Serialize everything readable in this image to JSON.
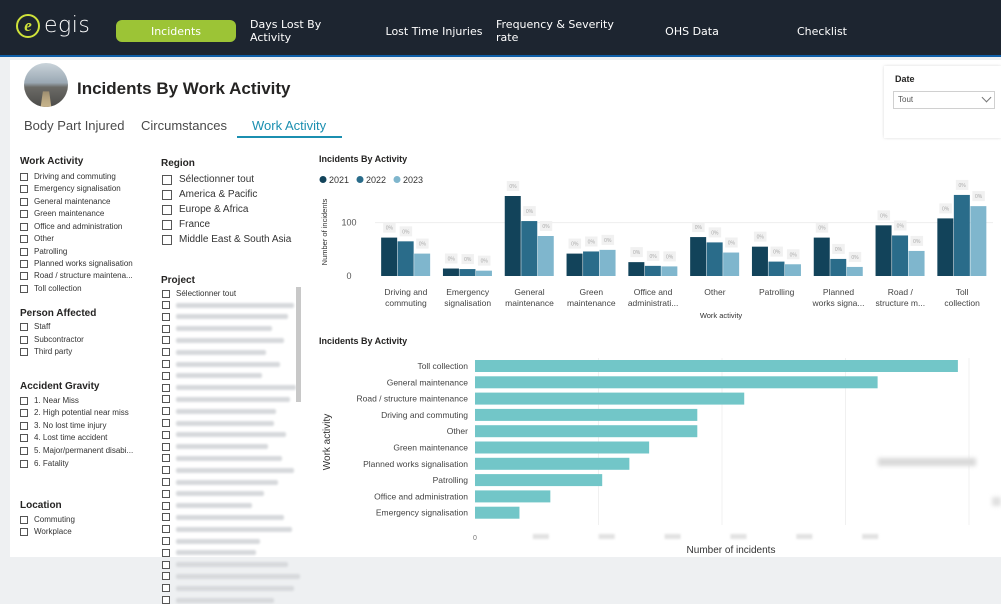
{
  "header": {
    "logo_text": "egis",
    "logo_mark": "e",
    "nav": [
      {
        "label": "Incidents",
        "active": true
      },
      {
        "label": "Days Lost By Activity",
        "active": false
      },
      {
        "label": "Lost Time Injuries",
        "active": false
      },
      {
        "label": "Frequency & Severity rate",
        "active": false
      },
      {
        "label": "OHS Data",
        "active": false
      },
      {
        "label": "Checklist",
        "active": false
      }
    ]
  },
  "page": {
    "title": "Incidents By Work Activity",
    "tabs": [
      {
        "label": "Body Part Injured",
        "active": false
      },
      {
        "label": "Circumstances",
        "active": false
      },
      {
        "label": "Work Activity",
        "active": true
      }
    ]
  },
  "date_filter": {
    "label": "Date",
    "value": "Tout"
  },
  "slicers": {
    "work_activity": {
      "title": "Work Activity",
      "items": [
        "Driving and commuting",
        "Emergency signalisation",
        "General maintenance",
        "Green maintenance",
        "Office and administration",
        "Other",
        "Patrolling",
        "Planned works signalisation",
        "Road / structure maintena...",
        "Toll collection"
      ]
    },
    "person_affected": {
      "title": "Person Affected",
      "items": [
        "Staff",
        "Subcontractor",
        "Third party"
      ]
    },
    "accident_gravity": {
      "title": "Accident Gravity",
      "items": [
        "1. Near Miss",
        "2. High potential near miss",
        "3. No lost time injury",
        "4. Lost time accident",
        "5. Major/permanent disabi...",
        "6. Fatality"
      ]
    },
    "location": {
      "title": "Location",
      "items": [
        "Commuting",
        "Workplace"
      ]
    },
    "region": {
      "title": "Region",
      "items": [
        "Sélectionner tout",
        "America & Pacific",
        "Europe & Africa",
        "France",
        "Middle East & South Asia"
      ]
    },
    "project": {
      "title": "Project",
      "items": [
        "Sélectionner tout"
      ]
    }
  },
  "colors": {
    "y2021": "#12435a",
    "y2022": "#2a6c8a",
    "y2023": "#7fb6cd",
    "hbar": "#72c6c8",
    "active_tab": "#9cc436",
    "accent": "#1b8fb0"
  },
  "chart_data": [
    {
      "type": "bar",
      "title": "Incidents By Activity",
      "xlabel": "Work activity",
      "ylabel": "Number of incidents",
      "yticks": [
        0,
        100
      ],
      "ylim": [
        0,
        165
      ],
      "legend_position": "top-left",
      "categories": [
        "Driving and commuting",
        "Emergency signalisation",
        "General maintenance",
        "Green maintenance",
        "Office and administrati...",
        "Other",
        "Patrolling",
        "Planned works signa...",
        "Road / structure m...",
        "Toll collection"
      ],
      "category_lines": [
        [
          "Driving and",
          "commuting"
        ],
        [
          "Emergency",
          "signalisation"
        ],
        [
          "General",
          "maintenance"
        ],
        [
          "Green",
          "maintenance"
        ],
        [
          "Office and",
          "administrati..."
        ],
        [
          "Other"
        ],
        [
          "Patrolling"
        ],
        [
          "Planned",
          "works signa..."
        ],
        [
          "Road /",
          "structure m..."
        ],
        [
          "Toll",
          "collection"
        ]
      ],
      "series": [
        {
          "name": "2021",
          "values": [
            72,
            14,
            150,
            42,
            26,
            73,
            55,
            72,
            95,
            108
          ]
        },
        {
          "name": "2022",
          "values": [
            65,
            13,
            103,
            46,
            19,
            63,
            27,
            32,
            76,
            152
          ]
        },
        {
          "name": "2023",
          "values": [
            42,
            10,
            75,
            49,
            18,
            44,
            22,
            17,
            47,
            131
          ]
        }
      ],
      "data_label": "0%"
    },
    {
      "type": "bar",
      "orientation": "horizontal",
      "title": "Incidents By Activity",
      "xlabel": "Number of incidents",
      "ylabel": "Work activity",
      "categories": [
        "Toll collection",
        "General maintenance",
        "Road / structure maintenance",
        "Driving and commuting",
        "Other",
        "Green maintenance",
        "Planned works signalisation",
        "Patrolling",
        "Office and administration",
        "Emergency signalisation"
      ],
      "values": [
        391,
        326,
        218,
        180,
        180,
        141,
        125,
        103,
        61,
        36
      ],
      "xlim": [
        0,
        400
      ],
      "xtick_first_label": "0"
    }
  ]
}
